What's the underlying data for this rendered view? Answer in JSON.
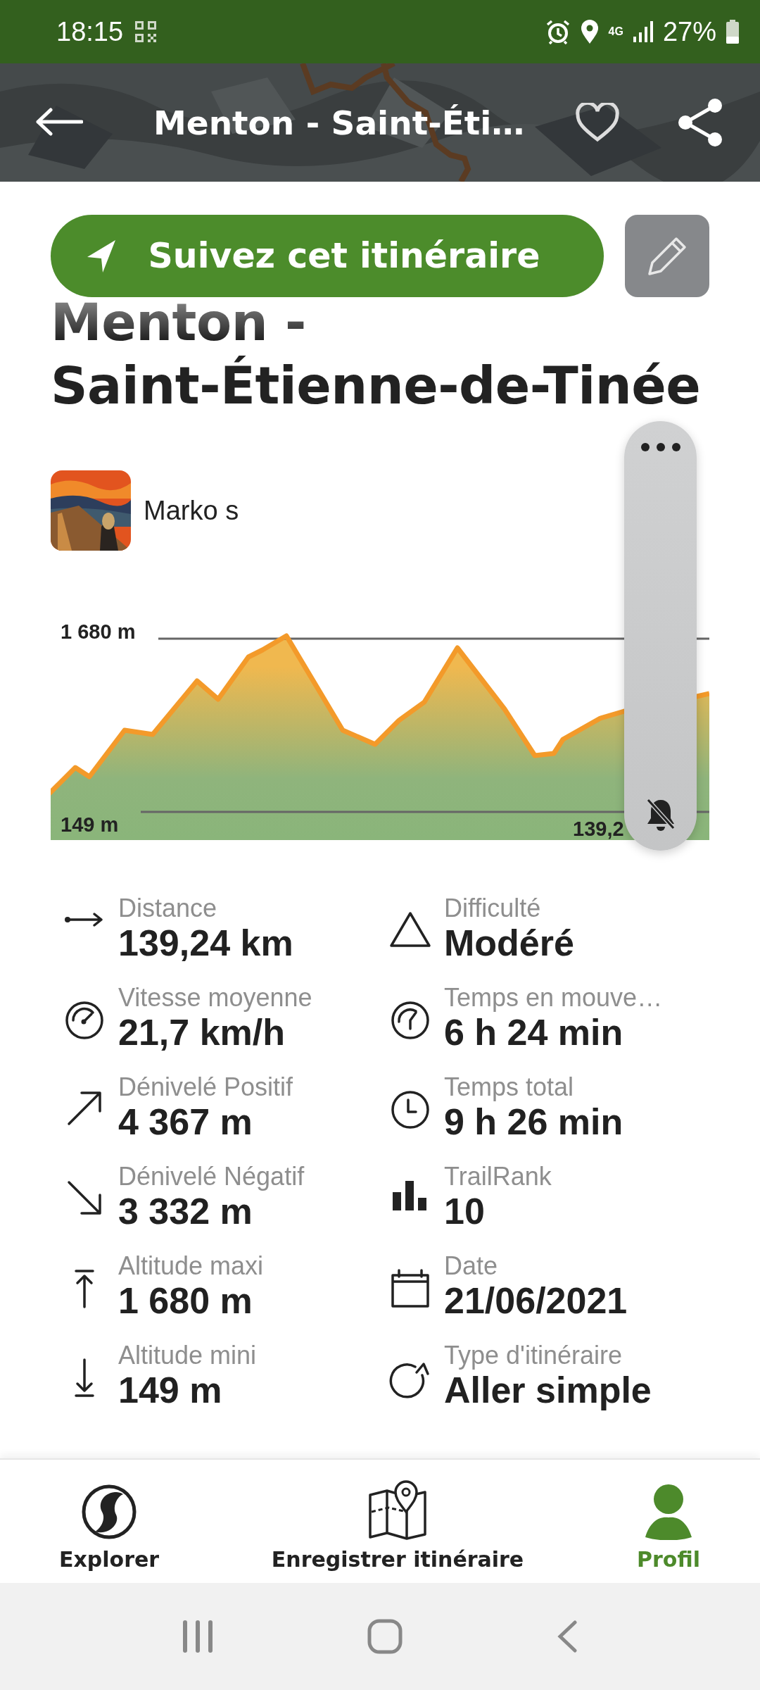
{
  "status_bar": {
    "time": "18:15",
    "network": "4G",
    "battery": "27%"
  },
  "header": {
    "title": "Menton - Saint-Éti…",
    "favorite": false
  },
  "follow_button": "Suivez cet itinéraire",
  "trail": {
    "title": "Menton - Saint-Étienne-de-Tinée",
    "author": "Marko s"
  },
  "profile": {
    "max_label": "1 680 m",
    "min_label": "149 m",
    "distance_label": "139,2"
  },
  "stats": [
    {
      "kind": "distance",
      "label": "Distance",
      "value": "139,24 km"
    },
    {
      "kind": "difficulty",
      "label": "Difficulté",
      "value": "Modéré"
    },
    {
      "kind": "speed",
      "label": "Vitesse moyenne",
      "value": "21,7 km/h"
    },
    {
      "kind": "moving_time",
      "label": "Temps en mouve…",
      "value": "6 h 24 min"
    },
    {
      "kind": "ascent",
      "label": "Dénivelé Positif",
      "value": "4 367 m"
    },
    {
      "kind": "total_time",
      "label": "Temps total",
      "value": "9 h 26 min"
    },
    {
      "kind": "descent",
      "label": "Dénivelé Négatif",
      "value": "3 332 m"
    },
    {
      "kind": "trailrank",
      "label": "TrailRank",
      "value": "10"
    },
    {
      "kind": "max_altitude",
      "label": "Altitude maxi",
      "value": "1 680 m"
    },
    {
      "kind": "date",
      "label": "Date",
      "value": "21/06/2021"
    },
    {
      "kind": "min_altitude",
      "label": "Altitude mini",
      "value": "149 m"
    },
    {
      "kind": "route_type",
      "label": "Type d'itinéraire",
      "value": "Aller simple"
    }
  ],
  "bottom_nav": [
    {
      "kind": "explore",
      "label": "Explorer",
      "selected": false
    },
    {
      "kind": "record",
      "label": "Enregistrer itinéraire",
      "selected": false
    },
    {
      "kind": "profile",
      "label": "Profil",
      "selected": true
    }
  ]
}
